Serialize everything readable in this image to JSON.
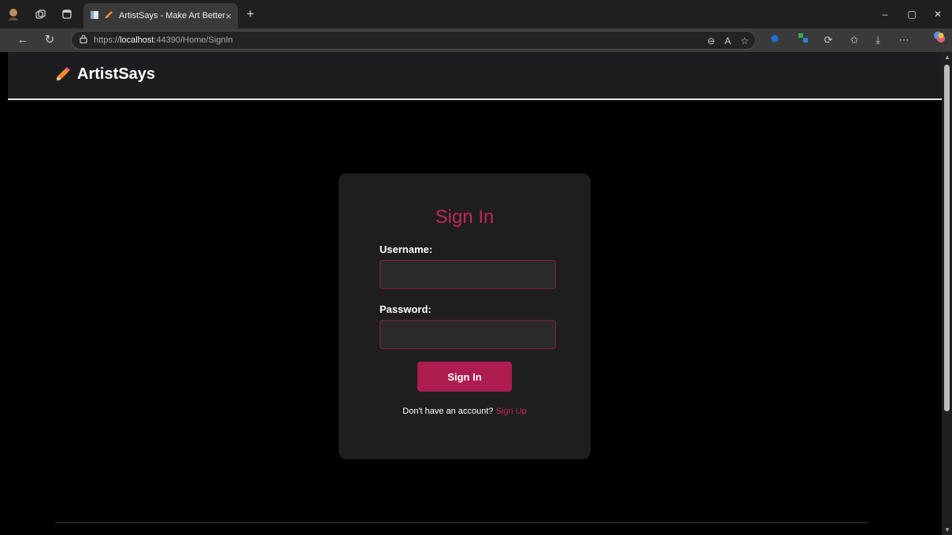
{
  "browser": {
    "tab_title": "ArtistSays - Make Art Better",
    "tab_close": "×",
    "new_tab": "+",
    "url_scheme": "https://",
    "url_host": "localhost",
    "url_rest": ":44390/Home/SignIn",
    "window_controls": {
      "minimize": "–",
      "maximize": "▢",
      "close": "✕"
    }
  },
  "header": {
    "brand": "ArtistSays"
  },
  "signin": {
    "title": "Sign In",
    "username_label": "Username:",
    "username_value": "",
    "password_label": "Password:",
    "password_value": "",
    "submit_label": "Sign In",
    "no_account_text": "Don't have an account?",
    "signup_link": "Sign Up"
  },
  "colors": {
    "accent": "#c2255c",
    "button": "#ad1d4f",
    "card": "#1e1e1e",
    "header": "#1d1d1f"
  }
}
